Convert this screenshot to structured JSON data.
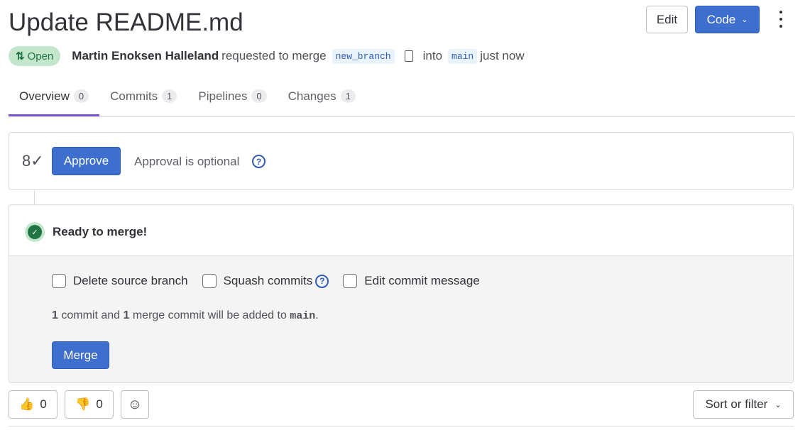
{
  "title": "Update README.md",
  "header": {
    "edit": "Edit",
    "code": "Code"
  },
  "meta": {
    "status": "Open",
    "author": "Martin Enoksen Halleland",
    "action": "requested to merge",
    "source": "new_branch",
    "into": "into",
    "target": "main",
    "time": "just now"
  },
  "tabs": [
    {
      "label": "Overview",
      "count": "0"
    },
    {
      "label": "Commits",
      "count": "1"
    },
    {
      "label": "Pipelines",
      "count": "0"
    },
    {
      "label": "Changes",
      "count": "1"
    }
  ],
  "approval": {
    "button": "Approve",
    "text": "Approval is optional"
  },
  "merge": {
    "status": "Ready to merge!",
    "options": [
      "Delete source branch",
      "Squash commits",
      "Edit commit message"
    ],
    "summary": {
      "n1": "1",
      "t1": " commit and ",
      "n2": "1",
      "t2": " merge commit will be added to ",
      "branch": "main",
      "end": "."
    },
    "button": "Merge"
  },
  "reactions": {
    "up": "0",
    "down": "0"
  },
  "sort": "Sort or filter"
}
